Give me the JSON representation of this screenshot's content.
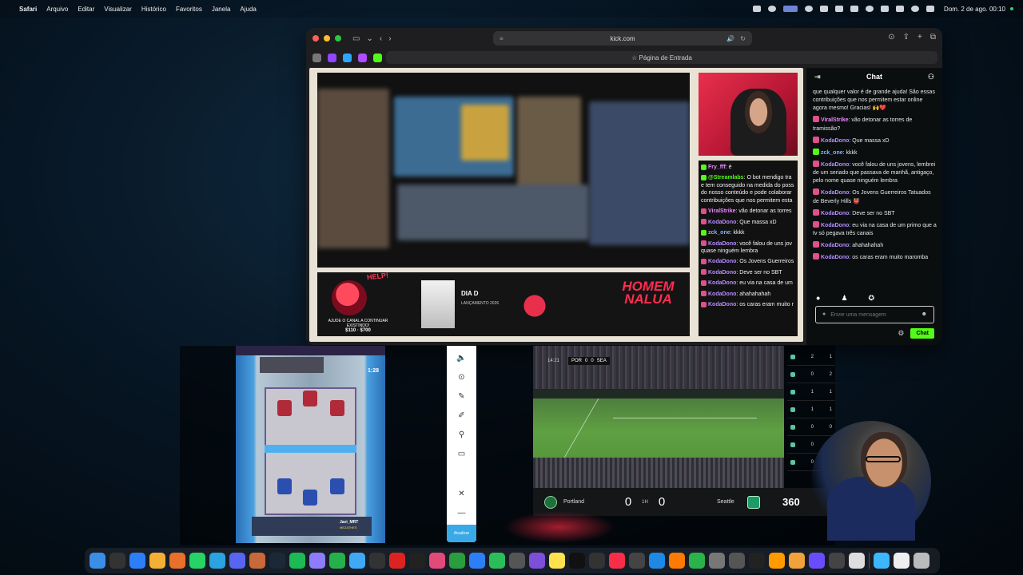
{
  "menubar": {
    "apple": "",
    "app_name": "Safari",
    "menus": [
      "Arquivo",
      "Editar",
      "Visualizar",
      "Histórico",
      "Favoritos",
      "Janela",
      "Ajuda"
    ],
    "clock": "Dom. 2 de ago.  00:10"
  },
  "browser": {
    "url": "kick.com",
    "start_page": "☆ Página de Entrada"
  },
  "overlay_chat": [
    {
      "user": "Fry_fff",
      "text": ": é"
    },
    {
      "user": "@Streamlabs",
      "text": ": O bot mendigo tra e tem conseguido na medida do poss do nosso conteúdo e pode colaborar contribuições que nos permitem esta"
    },
    {
      "user": "ViralStrike",
      "text": ": vão detonar as torres"
    },
    {
      "user": "KodaDono",
      "text": ": Que massa xD"
    },
    {
      "user": "zck_one",
      "text": ": kkkk"
    },
    {
      "user": "KodaDono",
      "text": ": você falou de uns jov quase ninguém lembra"
    },
    {
      "user": "KodaDono",
      "text": ": Os Jovens Guerreiros"
    },
    {
      "user": "KodaDono",
      "text": ": Deve ser no SBT"
    },
    {
      "user": "KodaDono",
      "text": ": eu via na casa de um"
    },
    {
      "user": "KodaDono",
      "text": ": ahahahahah"
    },
    {
      "user": "KodaDono",
      "text": ": os caras eram muito r"
    }
  ],
  "banner": {
    "help": "HELP!",
    "ajude": "AJUDE O CANAL A CONTINUAR EXISTINDO!",
    "price": "$110 · $700",
    "book_title": "DIA D",
    "book_meta": "LANÇAMENTO 2026",
    "homem": "HOMEM",
    "nalua": "NALUA"
  },
  "chat": {
    "title": "Chat",
    "messages": [
      {
        "user": "",
        "text": "que qualquer valor é de grande ajuda! São essas contribuições que nos permitem estar online agora mesmo! Gracias! 🙌❤️",
        "color": "#ffffff",
        "badge": ""
      },
      {
        "user": "ViralStrike",
        "text": ": vão detonar as torres de tramissão?",
        "color": "#e98aff",
        "badge": "#e0508a"
      },
      {
        "user": "KodaDono",
        "text": ": Que massa xD",
        "color": "#b58cff",
        "badge": "#e0508a"
      },
      {
        "user": "zck_one",
        "text": ": kkkk",
        "color": "#7fb6ff",
        "badge": "#53fc18"
      },
      {
        "user": "KodaDono",
        "text": ": você falou de uns jovens, lembrei de um seriado que passava de manhã, antigaço, pelo nome quase ninguém lembra",
        "color": "#b58cff",
        "badge": "#e0508a"
      },
      {
        "user": "KodaDono",
        "text": ": Os Jovens Guerreiros Tatuados de Beverly Hills 👹",
        "color": "#b58cff",
        "badge": "#e0508a"
      },
      {
        "user": "KodaDono",
        "text": ": Deve ser no SBT",
        "color": "#b58cff",
        "badge": "#e0508a"
      },
      {
        "user": "KodaDono",
        "text": ": eu via na casa de um primo que a tv só pegava três canais",
        "color": "#b58cff",
        "badge": "#e0508a"
      },
      {
        "user": "KodaDono",
        "text": ": ahahahahah",
        "color": "#b58cff",
        "badge": "#e0508a"
      },
      {
        "user": "KodaDono",
        "text": ": os caras eram muito maromba",
        "color": "#b58cff",
        "badge": "#e0508a"
      }
    ],
    "input_placeholder": "Envie uma mensagem",
    "send_label": "Chat"
  },
  "game": {
    "timer": "1:28",
    "player": "Javi_MRT",
    "clan": "MEZATHES"
  },
  "side_toolbar": {
    "update_label": "Atualizar"
  },
  "soccer": {
    "clock": "14:21",
    "team_a_short": "POR",
    "team_b_short": "SEA",
    "score_a": "0",
    "score_b": "0",
    "team_a": "Portland",
    "team_b": "Seattle",
    "half": "1H",
    "logo": "360"
  },
  "side_scores": [
    {
      "a": "2",
      "b": "1"
    },
    {
      "a": "0",
      "b": "2"
    },
    {
      "a": "1",
      "b": "1"
    },
    {
      "a": "1",
      "b": "1"
    },
    {
      "a": "0",
      "b": "0"
    },
    {
      "a": "0",
      "b": "0"
    },
    {
      "a": "0",
      "b": "0"
    }
  ],
  "dock_colors": [
    "#3a8ee6",
    "#333",
    "#2d7ff9",
    "#f2b134",
    "#e8702a",
    "#25d366",
    "#2aa3e0",
    "#5865f2",
    "#c9683a",
    "#1b2838",
    "#1db954",
    "#8e7cff",
    "#25b04b",
    "#3fa9f5",
    "#333",
    "#d22",
    "#222",
    "#e24a7a",
    "#2a9d3f",
    "#2d7ff9",
    "#2bbd59",
    "#555",
    "#7d4ed8",
    "#ffe14d",
    "#111",
    "#333",
    "#fa2d48",
    "#444",
    "#1e88e5",
    "#ff7a00",
    "#29b34a",
    "#777",
    "#555",
    "#222",
    "#ff9a00",
    "#f2a23a",
    "#6a4cff",
    "#444",
    "#ddd",
    "#3cb6ff",
    "#eee",
    "#bbb"
  ]
}
